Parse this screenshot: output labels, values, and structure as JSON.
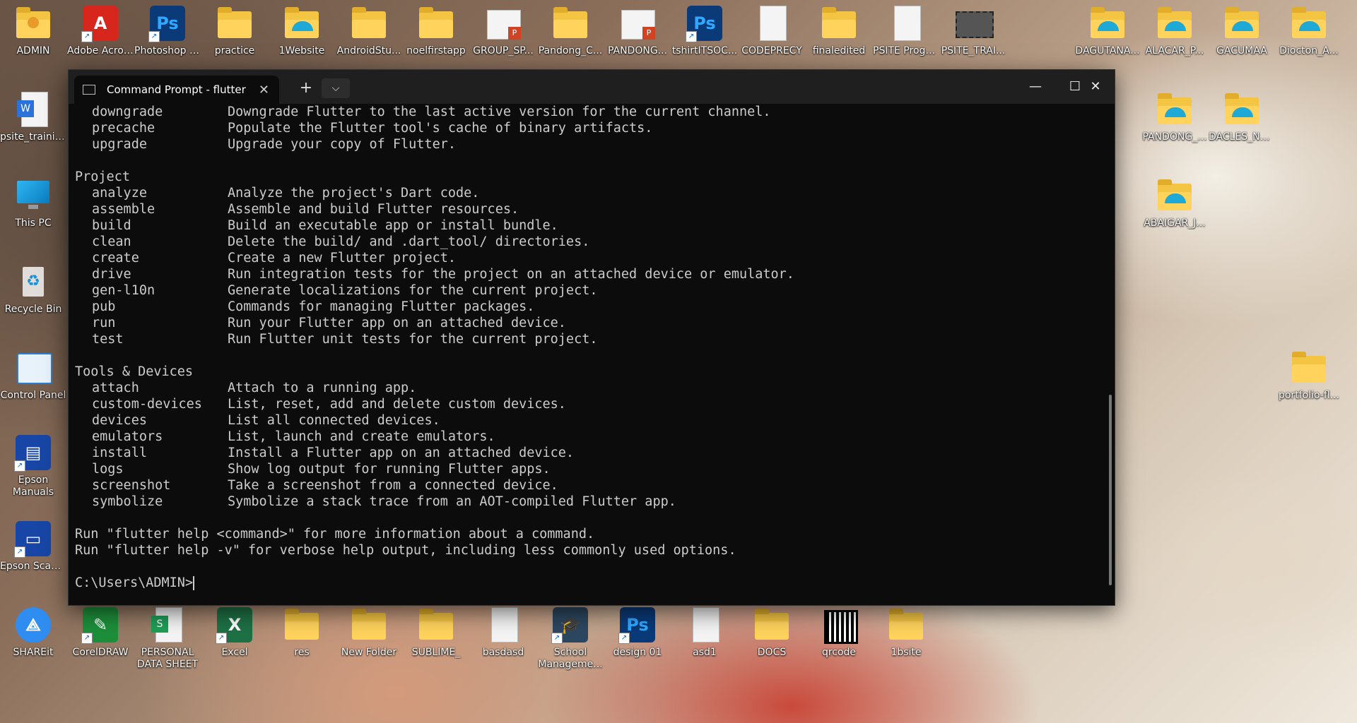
{
  "desktop": {
    "icons_top": [
      {
        "label": "ADMIN",
        "kind": "user-folder"
      },
      {
        "label": "Adobe Acrobat",
        "kind": "acrobat"
      },
      {
        "label": "Photoshop CS6",
        "kind": "photoshop"
      },
      {
        "label": "practice",
        "kind": "folder"
      },
      {
        "label": "1Website",
        "kind": "edge-folder"
      },
      {
        "label": "AndroidStu...",
        "kind": "folder"
      },
      {
        "label": "noelfirstapp",
        "kind": "folder"
      },
      {
        "label": "GROUP_SP...",
        "kind": "ppt"
      },
      {
        "label": "Pandong_C...",
        "kind": "folder"
      },
      {
        "label": "PANDONG...",
        "kind": "ppt"
      },
      {
        "label": "tshirtITSOC...",
        "kind": "photoshop"
      },
      {
        "label": "CODEPRECY",
        "kind": "doc"
      },
      {
        "label": "finaledited",
        "kind": "folder"
      },
      {
        "label": "PSITE Program...",
        "kind": "doc"
      },
      {
        "label": "PSITE_TRAI...",
        "kind": "video"
      }
    ],
    "icons_right": [
      {
        "label": "DAGUTANA...",
        "kind": "edge-folder"
      },
      {
        "label": "ALACAR_P...",
        "kind": "edge-folder"
      },
      {
        "label": "GACUMAA",
        "kind": "edge-folder"
      },
      {
        "label": "Diocton_A...",
        "kind": "edge-folder"
      },
      {
        "label": "PANDONG_...",
        "kind": "edge-folder"
      },
      {
        "label": "DACLES_NE...",
        "kind": "edge-folder"
      },
      {
        "label": "ABAIGAR_J...",
        "kind": "edge-folder"
      },
      {
        "label": "portfolio-fl...",
        "kind": "folder"
      }
    ],
    "icons_left": [
      {
        "label": "psite_trainin...",
        "kind": "word"
      },
      {
        "label": "This PC",
        "kind": "pc"
      },
      {
        "label": "Recycle Bin",
        "kind": "recycle"
      },
      {
        "label": "Control Panel",
        "kind": "control"
      },
      {
        "label": "Epson Manuals",
        "kind": "epson"
      },
      {
        "label": "Epson Scan 2",
        "kind": "scanner"
      },
      {
        "label": "SHAREit",
        "kind": "shareit"
      }
    ],
    "icons_bottom": [
      {
        "label": "CorelDRAW",
        "kind": "corel"
      },
      {
        "label": "PERSONAL DATA SHEET",
        "kind": "sheets"
      },
      {
        "label": "Excel",
        "kind": "excel"
      },
      {
        "label": "res",
        "kind": "folder"
      },
      {
        "label": "New Folder",
        "kind": "folder"
      },
      {
        "label": "SUBLIME_",
        "kind": "folder"
      },
      {
        "label": "basdasd",
        "kind": "doc"
      },
      {
        "label": "School Manageme...",
        "kind": "school"
      },
      {
        "label": "design 01",
        "kind": "photoshop"
      },
      {
        "label": "asd1",
        "kind": "doc"
      },
      {
        "label": "DOCS",
        "kind": "folder"
      },
      {
        "label": "qrcode",
        "kind": "qr"
      },
      {
        "label": "1bsite",
        "kind": "folder"
      }
    ]
  },
  "terminal": {
    "tab_title": "Command Prompt - flutter",
    "new_tab": "+",
    "dropdown": "⌵",
    "minimize": "—",
    "maximize": "☐",
    "close": "✕",
    "lines": [
      {
        "cmd": "downgrade",
        "desc": "Downgrade Flutter to the last active version for the current channel."
      },
      {
        "cmd": "precache",
        "desc": "Populate the Flutter tool's cache of binary artifacts."
      },
      {
        "cmd": "upgrade",
        "desc": "Upgrade your copy of Flutter."
      },
      {
        "text": ""
      },
      {
        "text": "Project"
      },
      {
        "cmd": "analyze",
        "desc": "Analyze the project's Dart code."
      },
      {
        "cmd": "assemble",
        "desc": "Assemble and build Flutter resources."
      },
      {
        "cmd": "build",
        "desc": "Build an executable app or install bundle."
      },
      {
        "cmd": "clean",
        "desc": "Delete the build/ and .dart_tool/ directories."
      },
      {
        "cmd": "create",
        "desc": "Create a new Flutter project."
      },
      {
        "cmd": "drive",
        "desc": "Run integration tests for the project on an attached device or emulator."
      },
      {
        "cmd": "gen-l10n",
        "desc": "Generate localizations for the current project."
      },
      {
        "cmd": "pub",
        "desc": "Commands for managing Flutter packages."
      },
      {
        "cmd": "run",
        "desc": "Run your Flutter app on an attached device."
      },
      {
        "cmd": "test",
        "desc": "Run Flutter unit tests for the current project."
      },
      {
        "text": ""
      },
      {
        "text": "Tools & Devices"
      },
      {
        "cmd": "attach",
        "desc": "Attach to a running app."
      },
      {
        "cmd": "custom-devices",
        "desc": "List, reset, add and delete custom devices."
      },
      {
        "cmd": "devices",
        "desc": "List all connected devices."
      },
      {
        "cmd": "emulators",
        "desc": "List, launch and create emulators."
      },
      {
        "cmd": "install",
        "desc": "Install a Flutter app on an attached device."
      },
      {
        "cmd": "logs",
        "desc": "Show log output for running Flutter apps."
      },
      {
        "cmd": "screenshot",
        "desc": "Take a screenshot from a connected device."
      },
      {
        "cmd": "symbolize",
        "desc": "Symbolize a stack trace from an AOT-compiled Flutter app."
      },
      {
        "text": ""
      },
      {
        "text": "Run \"flutter help <command>\" for more information about a command."
      },
      {
        "text": "Run \"flutter help -v\" for verbose help output, including less commonly used options."
      },
      {
        "text": ""
      }
    ],
    "prompt": "C:\\Users\\ADMIN>"
  }
}
